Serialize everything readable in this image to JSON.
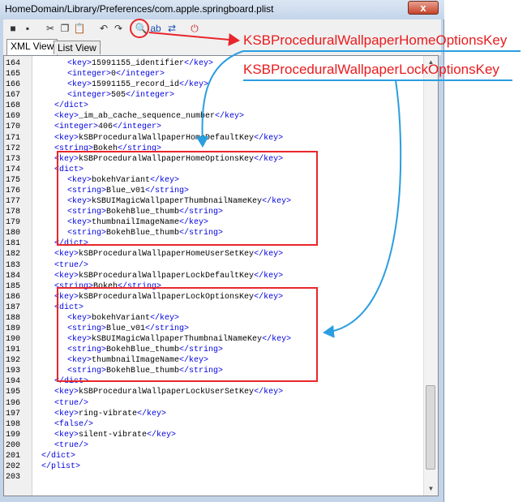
{
  "window": {
    "title": "HomeDomain/Library/Preferences/com.apple.springboard.plist",
    "close_label": "x"
  },
  "toolbar": [
    {
      "name": "new-icon",
      "glyph": "■"
    },
    {
      "name": "save-icon",
      "glyph": "▪"
    },
    {
      "name": "cut-icon",
      "glyph": "✂"
    },
    {
      "name": "copy-icon",
      "glyph": "❐"
    },
    {
      "name": "paste-icon",
      "glyph": "📋"
    },
    {
      "name": "undo-icon",
      "glyph": "↶"
    },
    {
      "name": "redo-icon",
      "glyph": "↷"
    },
    {
      "name": "find-icon",
      "glyph": "🔍"
    },
    {
      "name": "find-next-icon",
      "glyph": "ab"
    },
    {
      "name": "replace-icon",
      "glyph": "⇄"
    },
    {
      "name": "power-icon",
      "glyph": "⏻"
    }
  ],
  "tabs": [
    {
      "label": "XML View",
      "active": true
    },
    {
      "label": "List View",
      "active": false
    }
  ],
  "lines": [
    {
      "n": "164",
      "indent": 3,
      "parts": [
        [
          "tag",
          "<key>"
        ],
        [
          "txt",
          "15991155_identifier"
        ],
        [
          "tag",
          "</key>"
        ]
      ]
    },
    {
      "n": "165",
      "indent": 3,
      "parts": [
        [
          "tag",
          "<integer>"
        ],
        [
          "txt",
          "0"
        ],
        [
          "tag",
          "</integer>"
        ]
      ]
    },
    {
      "n": "166",
      "indent": 3,
      "parts": [
        [
          "tag",
          "<key>"
        ],
        [
          "txt",
          "15991155_record_id"
        ],
        [
          "tag",
          "</key>"
        ]
      ]
    },
    {
      "n": "167",
      "indent": 3,
      "parts": [
        [
          "tag",
          "<integer>"
        ],
        [
          "txt",
          "505"
        ],
        [
          "tag",
          "</integer>"
        ]
      ]
    },
    {
      "n": "168",
      "indent": 2,
      "parts": [
        [
          "tag",
          "</dict>"
        ]
      ]
    },
    {
      "n": "169",
      "indent": 2,
      "parts": [
        [
          "tag",
          "<key>"
        ],
        [
          "txt",
          "_im_ab_cache_sequence_number"
        ],
        [
          "tag",
          "</key>"
        ]
      ]
    },
    {
      "n": "170",
      "indent": 2,
      "parts": [
        [
          "tag",
          "<integer>"
        ],
        [
          "txt",
          "406"
        ],
        [
          "tag",
          "</integer>"
        ]
      ]
    },
    {
      "n": "171",
      "indent": 2,
      "parts": [
        [
          "tag",
          "<key>"
        ],
        [
          "txt",
          "kSBProceduralWallpaperHomeDefaultKey"
        ],
        [
          "tag",
          "</key>"
        ]
      ]
    },
    {
      "n": "172",
      "indent": 2,
      "parts": [
        [
          "tag",
          "<string>"
        ],
        [
          "txt",
          "Bokeh"
        ],
        [
          "tag",
          "</string>"
        ]
      ]
    },
    {
      "n": "173",
      "indent": 2,
      "parts": [
        [
          "tag",
          "<key>"
        ],
        [
          "txt",
          "kSBProceduralWallpaperHomeOptionsKey"
        ],
        [
          "tag",
          "</key>"
        ]
      ]
    },
    {
      "n": "174",
      "indent": 2,
      "parts": [
        [
          "tag",
          "<dict>"
        ]
      ]
    },
    {
      "n": "175",
      "indent": 3,
      "parts": [
        [
          "tag",
          "<key>"
        ],
        [
          "txt",
          "bokehVariant"
        ],
        [
          "tag",
          "</key>"
        ]
      ]
    },
    {
      "n": "176",
      "indent": 3,
      "parts": [
        [
          "tag",
          "<string>"
        ],
        [
          "txt",
          "Blue_v01"
        ],
        [
          "tag",
          "</string>"
        ]
      ]
    },
    {
      "n": "177",
      "indent": 3,
      "parts": [
        [
          "tag",
          "<key>"
        ],
        [
          "txt",
          "kSBUIMagicWallpaperThumbnailNameKey"
        ],
        [
          "tag",
          "</key>"
        ]
      ]
    },
    {
      "n": "178",
      "indent": 3,
      "parts": [
        [
          "tag",
          "<string>"
        ],
        [
          "txt",
          "BokehBlue_thumb"
        ],
        [
          "tag",
          "</string>"
        ]
      ]
    },
    {
      "n": "179",
      "indent": 3,
      "parts": [
        [
          "tag",
          "<key>"
        ],
        [
          "txt",
          "thumbnailImageName"
        ],
        [
          "tag",
          "</key>"
        ]
      ]
    },
    {
      "n": "180",
      "indent": 3,
      "parts": [
        [
          "tag",
          "<string>"
        ],
        [
          "txt",
          "BokehBlue_thumb"
        ],
        [
          "tag",
          "</string>"
        ]
      ]
    },
    {
      "n": "181",
      "indent": 2,
      "parts": [
        [
          "tag",
          "</dict>"
        ]
      ]
    },
    {
      "n": "182",
      "indent": 2,
      "parts": [
        [
          "tag",
          "<key>"
        ],
        [
          "txt",
          "kSBProceduralWallpaperHomeUserSetKey"
        ],
        [
          "tag",
          "</key>"
        ]
      ]
    },
    {
      "n": "183",
      "indent": 2,
      "parts": [
        [
          "tag",
          "<true/>"
        ]
      ]
    },
    {
      "n": "184",
      "indent": 2,
      "parts": [
        [
          "tag",
          "<key>"
        ],
        [
          "txt",
          "kSBProceduralWallpaperLockDefaultKey"
        ],
        [
          "tag",
          "</key>"
        ]
      ]
    },
    {
      "n": "185",
      "indent": 2,
      "parts": [
        [
          "tag",
          "<string>"
        ],
        [
          "txt",
          "Bokeh"
        ],
        [
          "tag",
          "</string>"
        ]
      ]
    },
    {
      "n": "186",
      "indent": 2,
      "parts": [
        [
          "tag",
          "<key>"
        ],
        [
          "txt",
          "kSBProceduralWallpaperLockOptionsKey"
        ],
        [
          "tag",
          "</key>"
        ]
      ]
    },
    {
      "n": "187",
      "indent": 2,
      "parts": [
        [
          "tag",
          "<dict>"
        ]
      ]
    },
    {
      "n": "188",
      "indent": 3,
      "parts": [
        [
          "tag",
          "<key>"
        ],
        [
          "txt",
          "bokehVariant"
        ],
        [
          "tag",
          "</key>"
        ]
      ]
    },
    {
      "n": "189",
      "indent": 3,
      "parts": [
        [
          "tag",
          "<string>"
        ],
        [
          "txt",
          "Blue_v01"
        ],
        [
          "tag",
          "</string>"
        ]
      ]
    },
    {
      "n": "190",
      "indent": 3,
      "parts": [
        [
          "tag",
          "<key>"
        ],
        [
          "txt",
          "kSBUIMagicWallpaperThumbnailNameKey"
        ],
        [
          "tag",
          "</key>"
        ]
      ]
    },
    {
      "n": "191",
      "indent": 3,
      "parts": [
        [
          "tag",
          "<string>"
        ],
        [
          "txt",
          "BokehBlue_thumb"
        ],
        [
          "tag",
          "</string>"
        ]
      ]
    },
    {
      "n": "192",
      "indent": 3,
      "parts": [
        [
          "tag",
          "<key>"
        ],
        [
          "txt",
          "thumbnailImageName"
        ],
        [
          "tag",
          "</key>"
        ]
      ]
    },
    {
      "n": "193",
      "indent": 3,
      "parts": [
        [
          "tag",
          "<string>"
        ],
        [
          "txt",
          "BokehBlue_thumb"
        ],
        [
          "tag",
          "</string>"
        ]
      ]
    },
    {
      "n": "194",
      "indent": 2,
      "parts": [
        [
          "tag",
          "</dict>"
        ]
      ]
    },
    {
      "n": "195",
      "indent": 2,
      "parts": [
        [
          "tag",
          "<key>"
        ],
        [
          "txt",
          "kSBProceduralWallpaperLockUserSetKey"
        ],
        [
          "tag",
          "</key>"
        ]
      ]
    },
    {
      "n": "196",
      "indent": 2,
      "parts": [
        [
          "tag",
          "<true/>"
        ]
      ]
    },
    {
      "n": "197",
      "indent": 2,
      "parts": [
        [
          "tag",
          "<key>"
        ],
        [
          "txt",
          "ring-vibrate"
        ],
        [
          "tag",
          "</key>"
        ]
      ]
    },
    {
      "n": "198",
      "indent": 2,
      "parts": [
        [
          "tag",
          "<false/>"
        ]
      ]
    },
    {
      "n": "199",
      "indent": 2,
      "parts": [
        [
          "tag",
          "<key>"
        ],
        [
          "txt",
          "silent-vibrate"
        ],
        [
          "tag",
          "</key>"
        ]
      ]
    },
    {
      "n": "200",
      "indent": 2,
      "parts": [
        [
          "tag",
          "<true/>"
        ]
      ]
    },
    {
      "n": "201",
      "indent": 1,
      "parts": [
        [
          "tag",
          "</dict>"
        ]
      ]
    },
    {
      "n": "202",
      "indent": 1,
      "parts": [
        [
          "tag",
          "</plist>"
        ]
      ]
    },
    {
      "n": "203",
      "indent": 0,
      "parts": []
    }
  ],
  "annotations": {
    "home_callout": "KSBProceduralWallpaperHomeOptionsKey",
    "lock_callout": "KSBProceduralWallpaperLockOptionsKey",
    "highlight_color": "#e8262b",
    "arrow_color": "#2a9ee0"
  },
  "colors": {
    "tag": "#0000e0",
    "text": "#000000",
    "gutter": "#f0f0f0"
  }
}
